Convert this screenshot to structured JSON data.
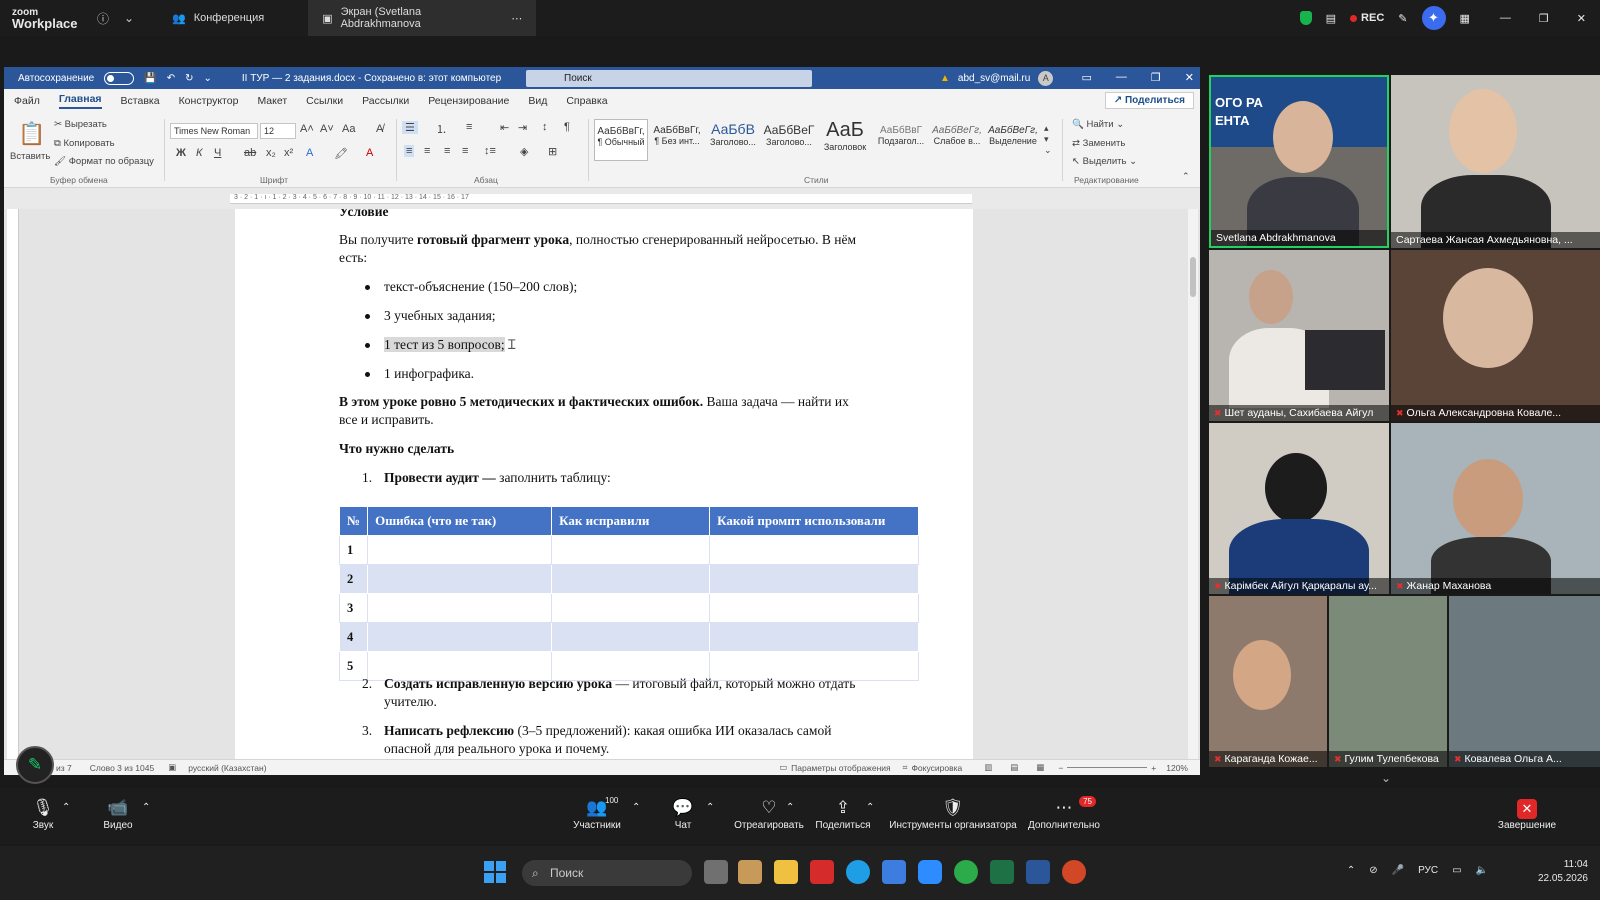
{
  "zoom_top": {
    "logo_line1": "zoom",
    "logo_line2": "Workplace",
    "tab_conference": "Конференция",
    "tab_screen": "Экран (Svetlana Abdrakhmanova",
    "rec_label": "REC"
  },
  "word": {
    "autosave_label": "Автосохранение",
    "doc_title": "II ТУР — 2 задания.docx - Сохранено в: этот компьютер",
    "search_placeholder": "Поиск",
    "user_email": "abd_sv@mail.ru",
    "user_initial": "A",
    "menu": [
      "Файл",
      "Главная",
      "Вставка",
      "Конструктор",
      "Макет",
      "Ссылки",
      "Рассылки",
      "Рецензирование",
      "Вид",
      "Справка"
    ],
    "share_label": "Поделиться",
    "ribbon": {
      "paste": "Вставить",
      "cut": "Вырезать",
      "copy": "Копировать",
      "format_painter": "Формат по образцу",
      "group_clipboard": "Буфер обмена",
      "font_name": "Times New Roman",
      "font_size": "12",
      "group_font": "Шрифт",
      "group_paragraph": "Абзац",
      "group_styles": "Стили",
      "group_editing": "Редактирование",
      "find": "Найти",
      "replace": "Заменить",
      "select": "Выделить",
      "styles": [
        {
          "sample": "АаБбВвГг,",
          "name": "¶ Обычный"
        },
        {
          "sample": "АаБбВвГг,",
          "name": "¶ Без инт..."
        },
        {
          "sample": "АаБбВ",
          "name": "Заголово..."
        },
        {
          "sample": "АаБбВеГ",
          "name": "Заголово..."
        },
        {
          "sample": "АаБ",
          "name": "Заголовок"
        },
        {
          "sample": "АаБбВвГ",
          "name": "Подзагол..."
        },
        {
          "sample": "АаБбВеГг,",
          "name": "Слабое в..."
        },
        {
          "sample": "АаБбВеГг,",
          "name": "Выделение"
        }
      ]
    },
    "doc": {
      "heading": "Условие",
      "intro_a": "Вы получите ",
      "intro_b": "готовый фрагмент урока",
      "intro_c": ", полностью сгенерированный нейросетью. В нём",
      "intro_d": "есть:",
      "bullets": [
        "текст-объяснение (150–200 слов);",
        "3 учебных задания;",
        "1 тест из 5 вопросов;",
        "1 инфографика."
      ],
      "errors_bold": "В этом уроке ровно 5 методических и фактических ошибок.",
      "errors_rest": " Ваша задача — найти их",
      "errors_line2": "все и исправить.",
      "todo_heading": "Что нужно сделать",
      "step1_num": "1.",
      "step1_bold": "Провести аудит —",
      "step1_rest": " заполнить таблицу:",
      "table_headers": [
        "№",
        "Ошибка (что не так)",
        "Как исправили",
        "Какой промпт использовали"
      ],
      "table_rows": [
        "1",
        "2",
        "3",
        "4",
        "5"
      ],
      "step2_num": "2.",
      "step2_bold": "Создать исправленную версию урока",
      "step2_rest": " — итоговый файл, который можно отдать",
      "step2_line2": "учителю.",
      "step3_num": "3.",
      "step3_bold": "Написать рефлексию",
      "step3_rest": " (3–5 предложений): какая ошибка ИИ оказалась самой",
      "step3_line2": "опасной для реального урока и почему."
    },
    "status": {
      "page": "из 7",
      "words": "Слово 3 из 1045",
      "lang": "русский (Казахстан)",
      "display_settings": "Параметры отображения",
      "focus": "Фокусировка",
      "zoom": "120%"
    }
  },
  "gallery": {
    "participants": [
      "Svetlana Abdrakhmanova",
      "Сартаева Жансая Ахмедьяновна, ...",
      "Шет ауданы, Сахибаева Айгул",
      "Ольга Александровна  Ковале...",
      "Карімбек Айгул Қарқаралы ау...",
      "Жанар Маханова",
      "Караганда  Кожае...",
      "Гулим Тулепбекова",
      "Ковалева Ольга А..."
    ],
    "banner_text1": "ОГО РА",
    "banner_text2": "ЕНТА"
  },
  "zoom_ctrl": {
    "audio": "Звук",
    "video": "Видео",
    "participants": "Участники",
    "participants_count": "100",
    "chat": "Чат",
    "react": "Отреагировать",
    "share": "Поделиться",
    "host_tools": "Инструменты организатора",
    "more": "Дополнительно",
    "more_badge": "75",
    "end": "Завершение"
  },
  "taskbar": {
    "search": "Поиск",
    "lang": "РУС",
    "time": "11:04",
    "date": "22.05.2026"
  },
  "colors": {
    "word_blue": "#2b579a",
    "table_header": "#4472c4",
    "table_band": "#d9e1f2",
    "speaking_border": "#23d160",
    "rec_red": "#e02828"
  }
}
